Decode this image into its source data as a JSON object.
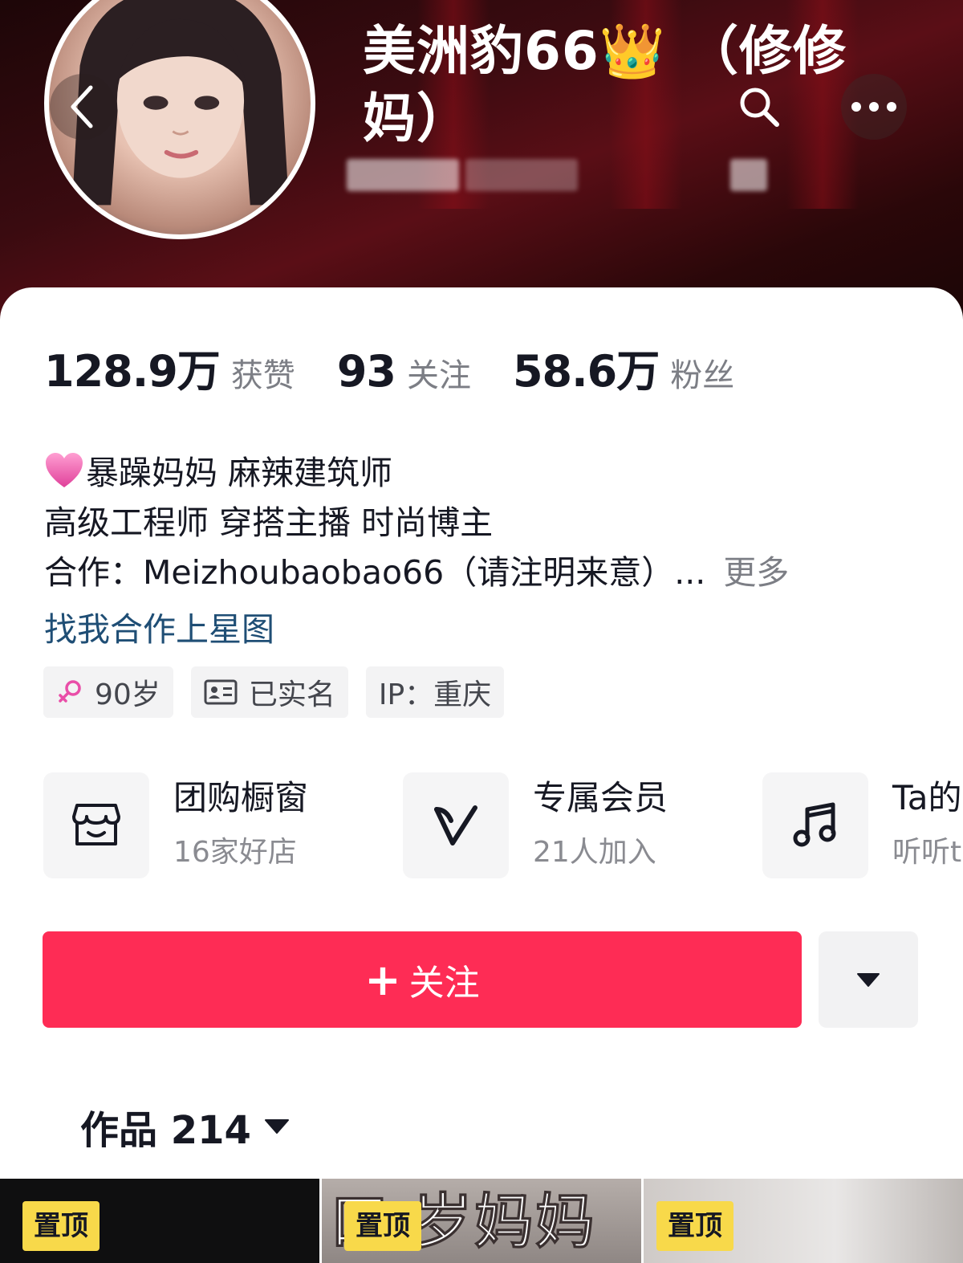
{
  "profile": {
    "nickname": "美洲豹66👑 （修修妈）",
    "stats": [
      {
        "value": "128.9万",
        "label": "获赞"
      },
      {
        "value": "93",
        "label": "关注"
      },
      {
        "value": "58.6万",
        "label": "粉丝"
      }
    ],
    "bio": {
      "line1": "暴躁妈妈 麻辣建筑师",
      "line2": "高级工程师 穿搭主播 时尚博主",
      "line3": "合作：Meizhoubaobao66（请注明来意）...",
      "more_label": "更多"
    },
    "star_link": "找我合作上星图",
    "tags": [
      {
        "icon": "female-icon",
        "label": "90岁"
      },
      {
        "icon": "id-card-icon",
        "label": "已实名"
      },
      {
        "icon": "",
        "label": "IP：重庆"
      }
    ]
  },
  "entries": [
    {
      "icon": "shop-icon",
      "title": "团购橱窗",
      "subtitle": "16家好店"
    },
    {
      "icon": "vip-v-icon",
      "title": "专属会员",
      "subtitle": "21人加入"
    },
    {
      "icon": "music-note-icon",
      "title": "Ta的",
      "subtitle": "听听t"
    }
  ],
  "actions": {
    "follow_label": "关注"
  },
  "works_tab": {
    "label": "作品 214"
  },
  "thumbnails": [
    {
      "pin_label": "置顶"
    },
    {
      "pin_label": "置顶",
      "overlay_text": "口 岁妈妈"
    },
    {
      "pin_label": "置顶"
    }
  ],
  "colors": {
    "accent": "#fe2c55",
    "link": "#1f4e75",
    "pin": "#f8d94a",
    "header_bg": "#3a0b10"
  }
}
